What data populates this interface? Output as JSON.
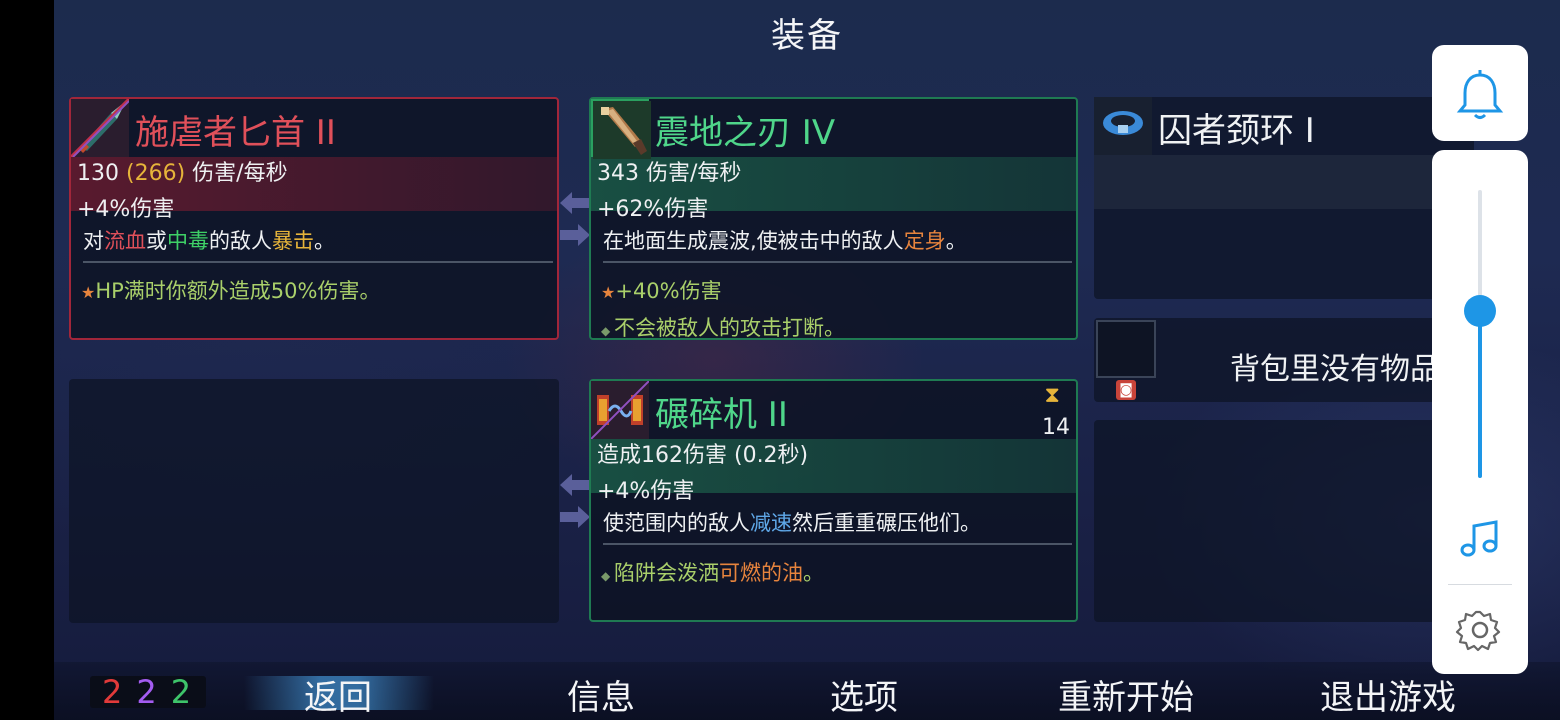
{
  "screen_title": "装备",
  "weapon_primary": {
    "name": "施虐者匕首 II",
    "name_color": "#e0505a",
    "dps_base": "130",
    "dps_crit": "(266)",
    "dps_unit": "伤害/每秒",
    "bonus": "+4%伤害",
    "desc_parts": [
      "对",
      "流血",
      "或",
      "中毒",
      "的敌人",
      "暴击",
      "。"
    ],
    "perk": "HP满时你额外造成50%伤害。",
    "icon": "dagger-icon"
  },
  "weapon_secondary": {
    "name": "震地之刃 IV",
    "name_color": "#4fd68a",
    "dps": "343 伤害/每秒",
    "bonus": "+62%伤害",
    "desc_parts": [
      "在地面生成震波,使被击中的敌人",
      "定身",
      "。"
    ],
    "perk_1": "+40%伤害",
    "perk_2": "不会被敌人的攻击打断。",
    "icon": "sword-icon"
  },
  "skill": {
    "name": "碾碎机 II",
    "name_color": "#4fd68a",
    "cooldown": "14",
    "damage": "造成162伤害 (0.2秒)",
    "bonus": "+4%伤害",
    "desc_parts": [
      "使范围内的敌人",
      "减速",
      "然后重重碾压他们。"
    ],
    "perk_parts": [
      "陷阱会泼洒",
      "可燃的油",
      "。"
    ],
    "icon": "crusher-icon"
  },
  "amulet": {
    "name": "囚者颈环 I",
    "icon": "collar-icon"
  },
  "backpack": {
    "empty_text": "背包里没有物品"
  },
  "counters": {
    "brutality": "2",
    "tactics": "2",
    "survival": "2",
    "colors": {
      "brutality": "#e23a3a",
      "tactics": "#a35cf0",
      "survival": "#3ec46a"
    }
  },
  "bottom_menu": {
    "back": "返回",
    "info": "信息",
    "options": "选项",
    "restart": "重新开始",
    "quit": "退出游戏"
  },
  "colors": {
    "red_keyword": "#e0505a",
    "green_keyword": "#3ed166",
    "yellow_keyword": "#e6b43a",
    "orange_keyword": "#e7843d",
    "blue_keyword": "#5fa8e8",
    "perk_green": "#a9cf6a",
    "accent_blue": "#1e96e6"
  },
  "system_overlay": {
    "volume_level": 0.58,
    "icons": [
      "bell-icon",
      "music-icon",
      "gear-icon"
    ]
  }
}
